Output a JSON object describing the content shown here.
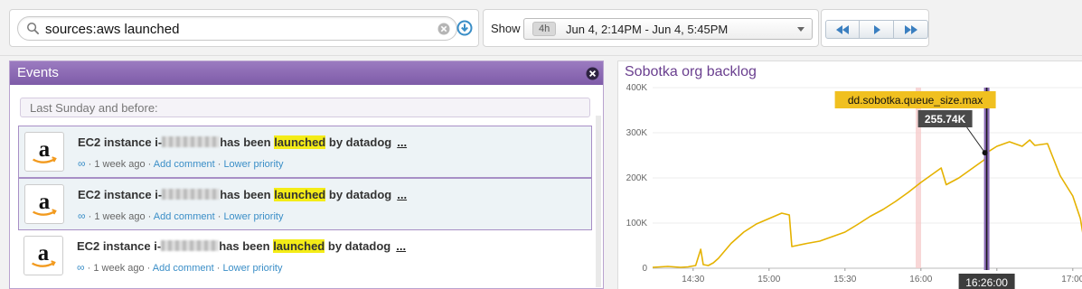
{
  "search": {
    "query": "sources:aws launched"
  },
  "timeframe": {
    "show_label": "Show",
    "badge": "4h",
    "range": "Jun 4, 2:14PM - Jun 4, 5:45PM"
  },
  "events": {
    "title": "Events",
    "section_label": "Last Sunday and before:",
    "items": [
      {
        "pre": "EC2 instance i-",
        "mid": "has been",
        "hl": "launched",
        "post": "by datadog",
        "more": "...",
        "link_icon": "∞",
        "age": "1 week ago",
        "comment": "Add comment",
        "priority": "Lower priority"
      },
      {
        "pre": "EC2 instance i-",
        "mid": "has been",
        "hl": "launched",
        "post": "by datadog",
        "more": "...",
        "link_icon": "∞",
        "age": "1 week ago",
        "comment": "Add comment",
        "priority": "Lower priority"
      },
      {
        "pre": "EC2 instance i-",
        "mid": "has been",
        "hl": "launched",
        "post": "by datadog",
        "more": "...",
        "link_icon": "∞",
        "age": "1 week ago",
        "comment": "Add comment",
        "priority": "Lower priority"
      }
    ]
  },
  "graph": {
    "title": "Sobotka org backlog",
    "tooltip_metric": "dd.sobotka.queue_size.max",
    "tooltip_value": "255.74K",
    "cursor_time": "16:26:00"
  },
  "chart_data": {
    "type": "line",
    "title": "Sobotka org backlog",
    "xlabel": "",
    "ylabel": "",
    "ylim": [
      0,
      400000
    ],
    "yticks": [
      0,
      100000,
      200000,
      300000,
      400000
    ],
    "ytick_labels": [
      "0",
      "100K",
      "200K",
      "300K",
      "400K"
    ],
    "xlim": [
      "14:14",
      "17:04"
    ],
    "xticks": [
      "14:30",
      "15:00",
      "15:30",
      "16:00",
      "16:30",
      "17:00"
    ],
    "grid": true,
    "color": "#e5b200",
    "series": [
      {
        "name": "dd.sobotka.queue_size.max",
        "x": [
          "14:14",
          "14:20",
          "14:25",
          "14:28",
          "14:31",
          "14:33",
          "14:34",
          "14:36",
          "14:38",
          "14:40",
          "14:45",
          "14:50",
          "14:55",
          "15:00",
          "15:05",
          "15:08",
          "15:09",
          "15:15",
          "15:20",
          "15:25",
          "15:30",
          "15:35",
          "15:40",
          "15:45",
          "15:50",
          "15:55",
          "16:00",
          "16:05",
          "16:08",
          "16:10",
          "16:15",
          "16:20",
          "16:25",
          "16:26",
          "16:30",
          "16:35",
          "16:40",
          "16:43",
          "16:45",
          "16:50",
          "16:55",
          "17:00",
          "17:03",
          "17:04"
        ],
        "values": [
          2000,
          4000,
          2000,
          3000,
          6000,
          42000,
          8000,
          6000,
          12000,
          22000,
          55000,
          80000,
          98000,
          110000,
          122000,
          118000,
          48000,
          55000,
          60000,
          70000,
          80000,
          97000,
          115000,
          130000,
          148000,
          168000,
          190000,
          210000,
          222000,
          185000,
          200000,
          220000,
          240000,
          255740,
          270000,
          280000,
          270000,
          284000,
          272000,
          276000,
          205000,
          160000,
          110000,
          76000
        ]
      }
    ],
    "annotations": [
      {
        "type": "event-marker",
        "x": "15:59"
      },
      {
        "type": "cursor",
        "x": "16:26",
        "label": "16:26:00"
      }
    ]
  }
}
